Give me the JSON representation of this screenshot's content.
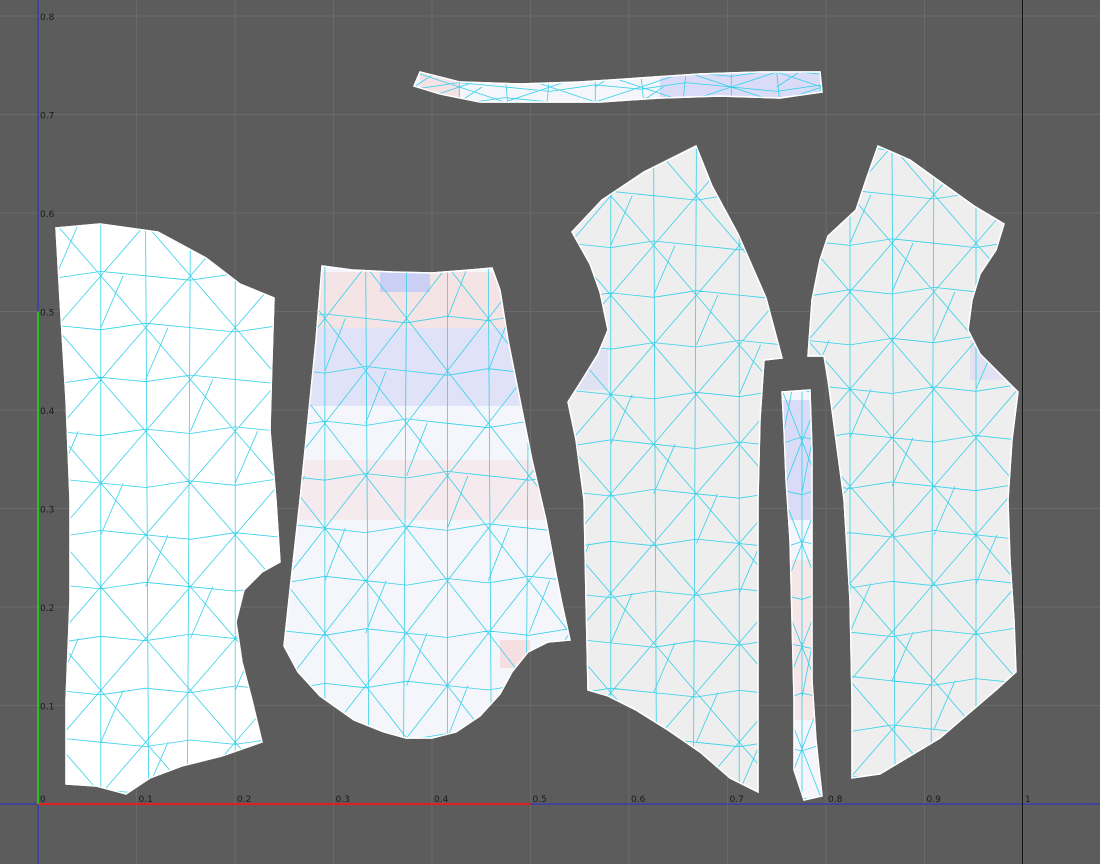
{
  "viewport": {
    "x_ticks": [
      "0",
      "0.1",
      "0.2",
      "0.3",
      "0.4",
      "0.5",
      "0.6",
      "0.7",
      "0.8",
      "0.9",
      "1"
    ],
    "y_ticks": [
      "0.1",
      "0.2",
      "0.3",
      "0.4",
      "0.5",
      "0.6",
      "0.7",
      "0.8"
    ],
    "colors": {
      "background": "#5c5c5c",
      "grid": "#6a6a6a",
      "u_axis": "#2b2bd0",
      "v_axis": "#2b2bd0",
      "u_axis_unit": "#e02020",
      "v_axis_unit": "#22c022",
      "island_fill_white": "#ffffff",
      "island_fill_light": "#f4f6fb",
      "island_fill_gray": "#eeeeee",
      "wireframe": "#35d0ea",
      "stretch_blue": "#c8ccf5",
      "stretch_red": "#f6d6d6"
    }
  },
  "islands": [
    {
      "name": "uv-island-back-panel",
      "fill": "white"
    },
    {
      "name": "uv-island-sleeve",
      "fill": "light"
    },
    {
      "name": "uv-island-front-left",
      "fill": "gray"
    },
    {
      "name": "uv-island-front-right",
      "fill": "gray"
    },
    {
      "name": "uv-island-placket",
      "fill": "light"
    },
    {
      "name": "uv-island-collar",
      "fill": "light"
    }
  ]
}
